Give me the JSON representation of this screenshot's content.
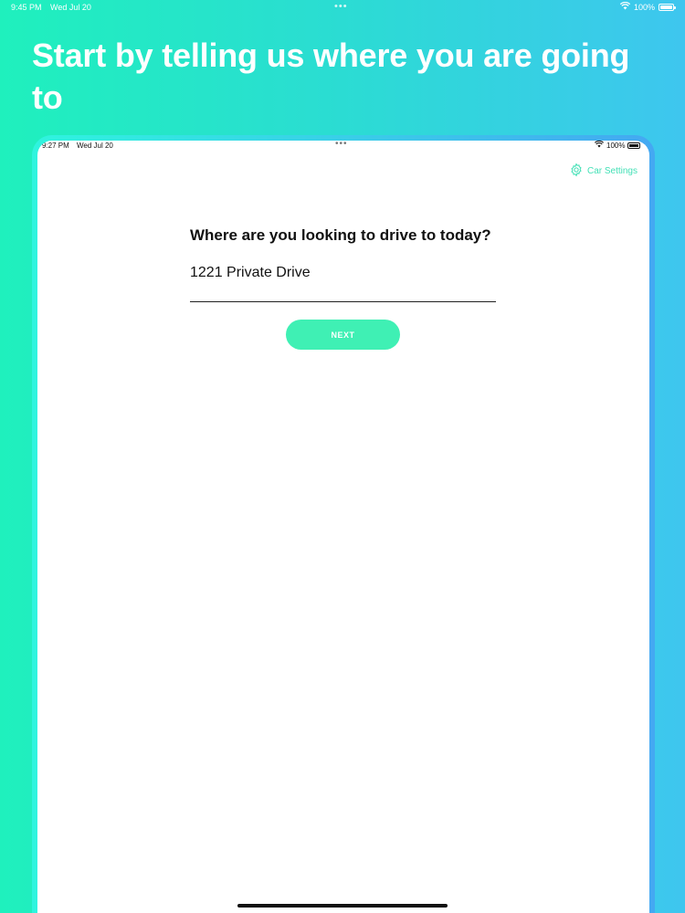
{
  "status_bar": {
    "time": "9:45 PM",
    "date": "Wed Jul 20",
    "battery": "100%"
  },
  "headline": "Start by telling us where you are going to",
  "device": {
    "status_bar": {
      "time": "9:27 PM",
      "date": "Wed Jul 20",
      "battery": "100%"
    },
    "car_settings_label": "Car Settings",
    "question": "Where are you looking to drive to today?",
    "destination_value": "1221 Private Drive",
    "next_label": "NEXT"
  },
  "colors": {
    "accent": "#3ff0b4",
    "gradient_start": "#1ff0bd",
    "gradient_end": "#3ec6ef"
  },
  "icons": {
    "settings": "gear-icon",
    "wifi": "wifi-icon",
    "battery": "battery-icon"
  }
}
